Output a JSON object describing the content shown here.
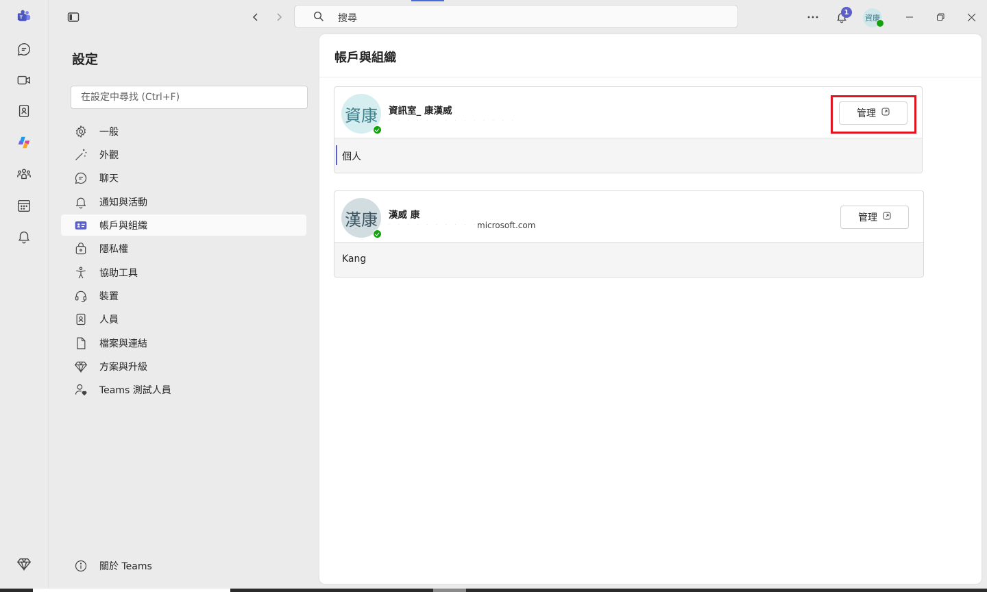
{
  "window": {
    "search_placeholder": "搜尋",
    "notification_count": "1",
    "user_initials": "資康"
  },
  "rail": {
    "items": [
      "teams-logo",
      "chat",
      "meet",
      "contacts",
      "copilot",
      "communities",
      "calendar",
      "activity"
    ],
    "bottom": "premium"
  },
  "settings": {
    "title": "設定",
    "search_placeholder": "在設定中尋找 (Ctrl+F)",
    "menu": [
      {
        "label": "一般",
        "icon": "gear-icon"
      },
      {
        "label": "外觀",
        "icon": "magic-wand-icon"
      },
      {
        "label": "聊天",
        "icon": "chat-icon"
      },
      {
        "label": "通知與活動",
        "icon": "bell-icon"
      },
      {
        "label": "帳戶與組織",
        "icon": "contact-card-icon",
        "active": true
      },
      {
        "label": "隱私權",
        "icon": "lock-icon"
      },
      {
        "label": "協助工具",
        "icon": "accessibility-icon"
      },
      {
        "label": "裝置",
        "icon": "headset-icon"
      },
      {
        "label": "人員",
        "icon": "person-card-icon"
      },
      {
        "label": "檔案與連結",
        "icon": "document-icon"
      },
      {
        "label": "方案與升級",
        "icon": "diamond-icon"
      },
      {
        "label": "Teams 測試人員",
        "icon": "person-heart-icon"
      }
    ],
    "about": "關於 Teams"
  },
  "content": {
    "title": "帳戶與組織",
    "accounts": [
      {
        "initials": "資康",
        "name": "資訊室_ 康漢威",
        "email": "",
        "manage_label": "管理",
        "org": "個人",
        "avatar_bg": "#d6eef0",
        "avatar_fg": "#3d7f8a"
      },
      {
        "initials": "漢康",
        "name": "漢威 康",
        "email": "microsoft.com",
        "manage_label": "管理",
        "org": "Kang",
        "avatar_bg": "#d2dde2",
        "avatar_fg": "#3d5561"
      }
    ]
  },
  "colors": {
    "accent": "#5b5fc7",
    "presence": "#13a10e",
    "highlight": "#e0141e"
  }
}
